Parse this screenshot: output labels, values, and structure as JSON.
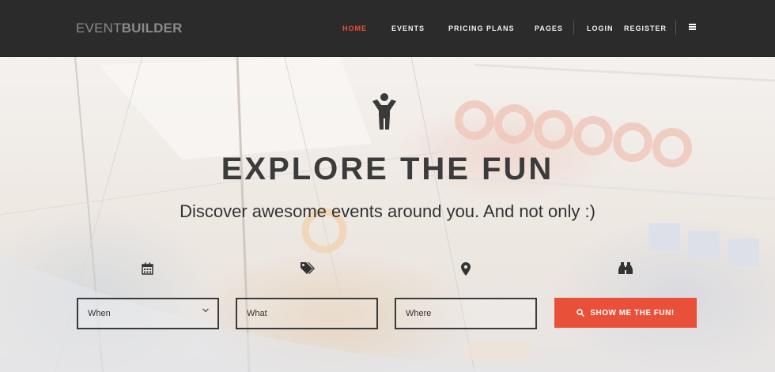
{
  "header": {
    "logo": {
      "part1": "EVENT",
      "part2": "BUILDER"
    },
    "nav": [
      {
        "label": "HOME",
        "active": true
      },
      {
        "label": "EVENTS"
      },
      {
        "label": "PRICING PLANS"
      },
      {
        "label": "PAGES"
      },
      {
        "label": "LOGIN"
      },
      {
        "label": "REGISTER"
      }
    ],
    "menu_icon": "hamburger-menu-icon"
  },
  "hero": {
    "icon": "person-icon",
    "title": "EXPLORE THE FUN",
    "subtitle": "Discover awesome events around you. And not only :)"
  },
  "search": {
    "icons": [
      "calendar-icon",
      "tags-icon",
      "map-marker-icon",
      "binoculars-icon"
    ],
    "when_placeholder": "When",
    "what_placeholder": "What",
    "where_placeholder": "Where",
    "submit_label": "SHOW ME THE FUN!"
  },
  "colors": {
    "accent": "#e8503a",
    "header_bg": "#2b2b2b",
    "text_dark": "#3b3b3b"
  }
}
